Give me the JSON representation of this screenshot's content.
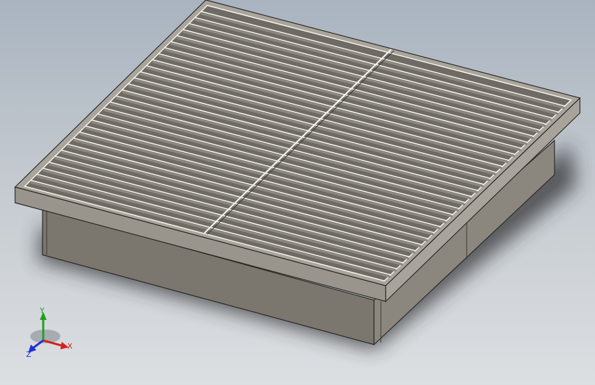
{
  "viewport": {
    "background_top": "#a9b4c0",
    "background_bottom": "#dcdfe2"
  },
  "model": {
    "type": "floor-grating-frame",
    "frame_color": "#9c968c",
    "frame_dark": "#6e6a63",
    "frame_side": "#7f7a72",
    "bar_color": "#8a847b",
    "bar_highlight": "#f2f2ee"
  },
  "triad": {
    "x_label": "X",
    "y_label": "Y",
    "z_label": "Z",
    "x_color": "#d42020",
    "y_color": "#20a020",
    "z_color": "#2030d0"
  }
}
